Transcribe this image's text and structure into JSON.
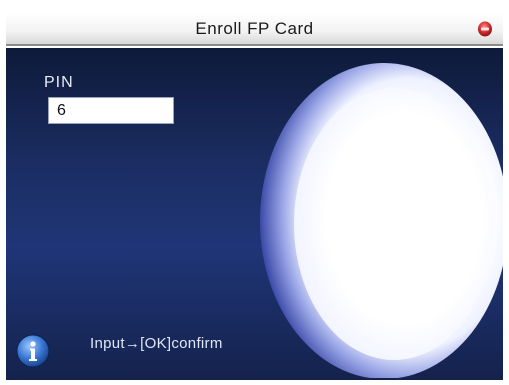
{
  "title_bar": {
    "title": "Enroll FP Card",
    "close_icon": "close-circle-icon"
  },
  "form": {
    "pin_label": "PIN",
    "pin_value": "6"
  },
  "footer": {
    "info_icon": "info-icon",
    "hint": "Input→[OK]confirm"
  },
  "colors": {
    "background_top": "#0e1a3a",
    "background_mid": "#1f3577",
    "close_red": "#c8282a",
    "info_blue": "#2d6ec8"
  }
}
